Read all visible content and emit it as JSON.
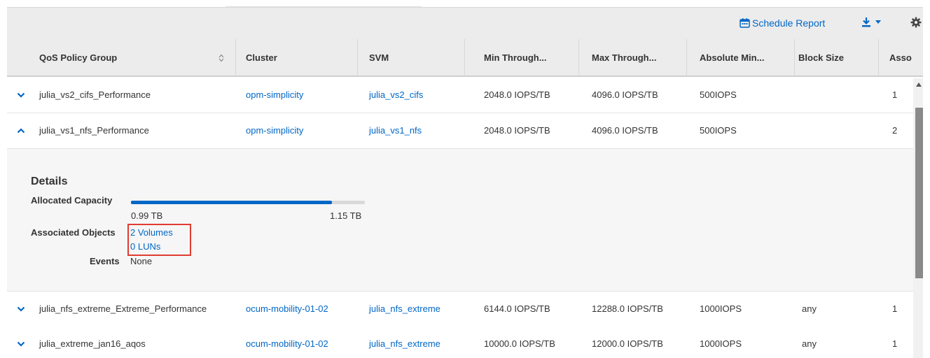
{
  "toolbar": {
    "schedule_report_label": "Schedule Report",
    "icons": {
      "schedule": "calendar-icon",
      "download": "download-icon",
      "dropdown": "caret-down-icon",
      "settings": "gear-icon"
    }
  },
  "columns": [
    "QoS Policy Group",
    "Cluster",
    "SVM",
    "Min Through...",
    "Max Through...",
    "Absolute Min...",
    "Block Size",
    "Asso"
  ],
  "rows": [
    {
      "expanded": false,
      "policy": "julia_vs2_cifs_Performance",
      "cluster": "opm-simplicity",
      "svm": "julia_vs2_cifs",
      "min": "2048.0 IOPS/TB",
      "max": "4096.0 IOPS/TB",
      "abs_min": "500IOPS",
      "block": "",
      "assoc": "1"
    },
    {
      "expanded": true,
      "policy": "julia_vs1_nfs_Performance",
      "cluster": "opm-simplicity",
      "svm": "julia_vs1_nfs",
      "min": "2048.0 IOPS/TB",
      "max": "4096.0 IOPS/TB",
      "abs_min": "500IOPS",
      "block": "",
      "assoc": "2"
    },
    {
      "expanded": false,
      "policy": "julia_nfs_extreme_Extreme_Performance",
      "cluster": "ocum-mobility-01-02",
      "svm": "julia_nfs_extreme",
      "min": "6144.0 IOPS/TB",
      "max": "12288.0 IOPS/TB",
      "abs_min": "1000IOPS",
      "block": "any",
      "assoc": "1"
    },
    {
      "expanded": false,
      "policy": "julia_extreme_jan16_aqos",
      "cluster": "ocum-mobility-01-02",
      "svm": "julia_nfs_extreme",
      "min": "10000.0 IOPS/TB",
      "max": "12000.0 IOPS/TB",
      "abs_min": "1000IOPS",
      "block": "any",
      "assoc": "1"
    }
  ],
  "details": {
    "title": "Details",
    "allocated_label": "Allocated Capacity",
    "allocated_used": "0.99 TB",
    "allocated_total": "1.15 TB",
    "allocated_fraction": 0.86,
    "associated_label": "Associated Objects",
    "volumes_link": "2 Volumes",
    "luns_link": "0 LUNs",
    "events_label": "Events",
    "events_value": "None"
  },
  "colors": {
    "link": "#0067c5",
    "header_bg": "#ececec",
    "highlight": "#e03c31"
  }
}
